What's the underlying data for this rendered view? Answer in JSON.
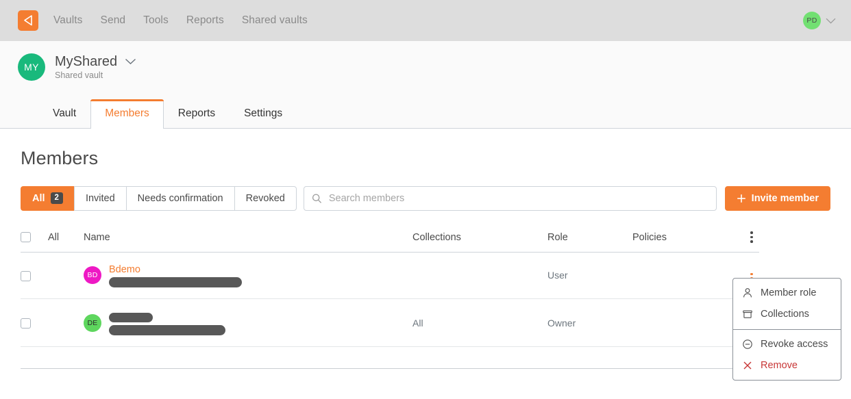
{
  "topnav": {
    "logo_icon": "bitwarden-shield-logo",
    "links": [
      {
        "label": "Vaults"
      },
      {
        "label": "Send"
      },
      {
        "label": "Tools"
      },
      {
        "label": "Reports"
      },
      {
        "label": "Shared vaults"
      }
    ],
    "account": {
      "initials": "PD",
      "avatar_color": "#72e072",
      "chevron_icon": "chevron-down-icon"
    }
  },
  "organization": {
    "initials": "MY",
    "avatar_color": "#19b97c",
    "name": "MyShared",
    "subtitle": "Shared vault",
    "chevron_icon": "chevron-down-icon"
  },
  "tabs": [
    {
      "label": "Vault",
      "active": false
    },
    {
      "label": "Members",
      "active": true
    },
    {
      "label": "Reports",
      "active": false
    },
    {
      "label": "Settings",
      "active": false
    }
  ],
  "page": {
    "title": "Members"
  },
  "filters": [
    {
      "label": "All",
      "badge": "2",
      "active": true
    },
    {
      "label": "Invited",
      "badge": null,
      "active": false
    },
    {
      "label": "Needs confirmation",
      "badge": null,
      "active": false
    },
    {
      "label": "Revoked",
      "badge": null,
      "active": false
    }
  ],
  "search": {
    "placeholder": "Search members",
    "value": "",
    "icon": "search-icon"
  },
  "invite_button": {
    "label": "Invite member",
    "icon": "plus-icon"
  },
  "table": {
    "headers": {
      "select_all": "All",
      "name": "Name",
      "collections": "Collections",
      "role": "Role",
      "policies": "Policies",
      "menu_icon": "kebab-menu-icon"
    },
    "rows": [
      {
        "initials": "BD",
        "avatar_color": "#ee19c4",
        "avatar_text_color": "#ffffff",
        "name": "Bdemo",
        "name_redacted": false,
        "email": "",
        "email_redacted": true,
        "email_redact_width": 194,
        "collections": "",
        "role": "User",
        "policies": "",
        "menu_icon": "kebab-menu-icon",
        "menu_open": true
      },
      {
        "initials": "DE",
        "avatar_color": "#5ed65e",
        "avatar_text_color": "#2b2b2b",
        "name": "",
        "name_redacted": true,
        "name_redact_width": 64,
        "email": "",
        "email_redacted": true,
        "email_redact_width": 170,
        "collections": "All",
        "role": "Owner",
        "policies": "",
        "menu_icon": "kebab-menu-icon",
        "menu_open": false
      }
    ]
  },
  "context_menu": {
    "items": [
      {
        "label": "Member role",
        "icon": "user-icon",
        "danger": false
      },
      {
        "label": "Collections",
        "icon": "collection-box-icon",
        "danger": false
      },
      {
        "label": "Revoke access",
        "icon": "minus-circle-icon",
        "danger": false
      },
      {
        "label": "Remove",
        "icon": "close-x-icon",
        "danger": true
      }
    ]
  },
  "colors": {
    "accent": "#f47d31",
    "danger": "#c83737",
    "topnav_bg": "#dddddd",
    "org_band_bg": "#fafafa",
    "border": "#ced4da",
    "text": "#4a4a4a",
    "muted": "#6c757d"
  }
}
